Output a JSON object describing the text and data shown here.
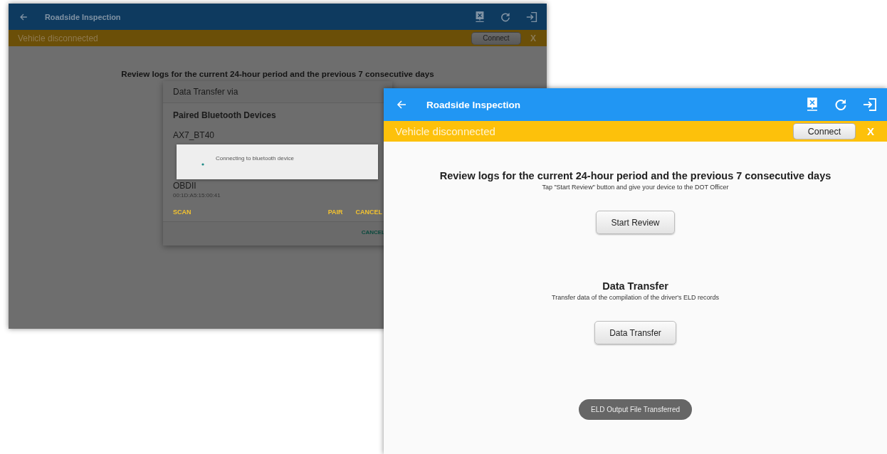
{
  "screens": [
    {
      "kind": "background",
      "dimmed": true,
      "toolbar": {
        "title": "Roadside Inspection"
      },
      "banner": {
        "message": "Vehicle disconnected",
        "button": "Connect",
        "close": "X"
      },
      "sections": [
        {
          "heading": "Review logs for the current 24-hour period and the previous 7 consecutive days"
        }
      ],
      "dialog": {
        "title": "Data Transfer via",
        "subtitle": "Paired Bluetooth Devices",
        "devices": [
          {
            "name": "AX7_BT40"
          },
          {
            "name": "OBDII",
            "address": "00:1D:A5:15:00:41"
          }
        ],
        "actions": [
          "SCAN",
          "PAIR",
          "CANCEL"
        ],
        "footer_button": "CANCEL",
        "progress": {
          "message": "Connecting to bluetooth device"
        }
      }
    },
    {
      "kind": "foreground",
      "dimmed": false,
      "toolbar": {
        "title": "Roadside Inspection"
      },
      "banner": {
        "message": "Vehicle disconnected",
        "button": "Connect",
        "close": "X"
      },
      "sections": [
        {
          "heading": "Review logs for the current 24-hour period and the previous 7 consecutive days",
          "description": "Tap \"Start Review\" button and give your device to the DOT Officer",
          "button": "Start Review"
        },
        {
          "heading": "Data Transfer",
          "description": "Transfer data of the compilation of the driver's ELD records",
          "button": "Data Transfer"
        }
      ],
      "toast": "ELD Output File Transferred"
    }
  ]
}
